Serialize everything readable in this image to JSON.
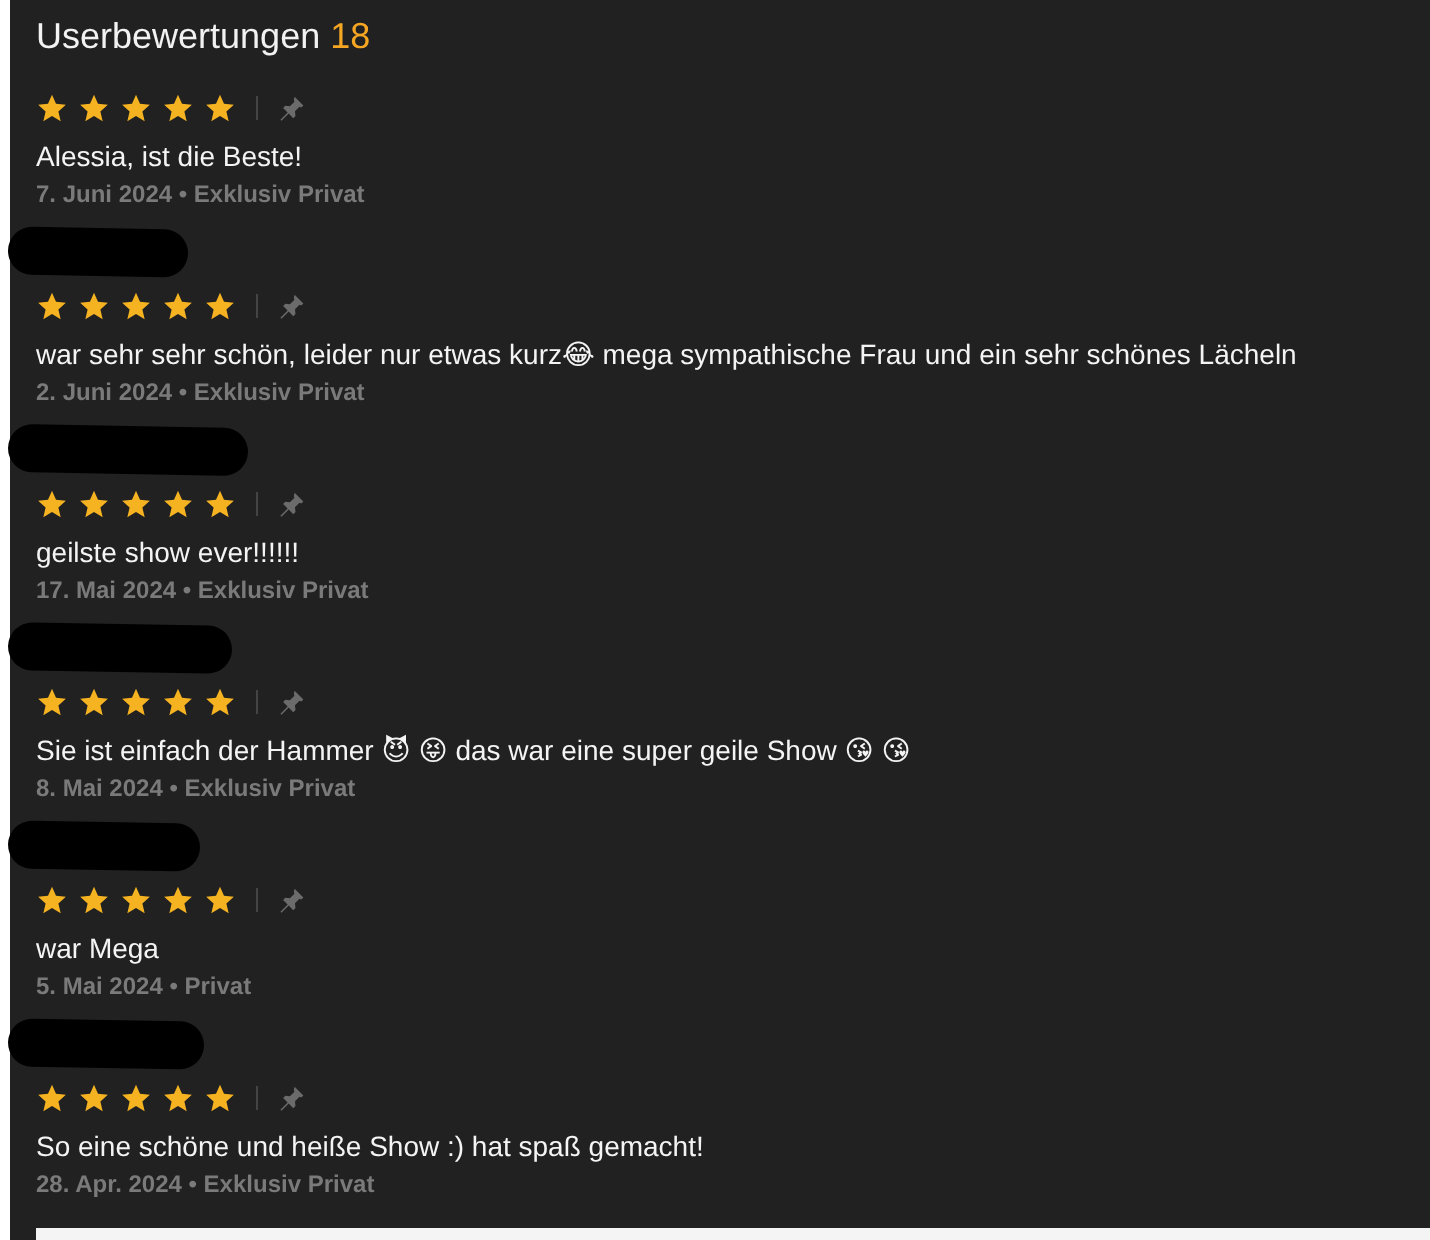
{
  "header": {
    "title": "Userbewertungen",
    "count": "18"
  },
  "reviews": [
    {
      "stars": 5,
      "text": "Alessia, ist die Beste!",
      "meta": "7. Juni 2024 • Exklusiv Privat"
    },
    {
      "name_redacted": true,
      "stars": 5,
      "text": "war sehr sehr schön, leider nur etwas kurz😂 mega sympathische Frau und ein sehr schönes Lächeln",
      "meta": "2. Juni 2024 • Exklusiv Privat"
    },
    {
      "name_redacted": true,
      "stars": 5,
      "text": "geilste show ever!!!!!!",
      "meta": "17. Mai 2024 • Exklusiv Privat"
    },
    {
      "name_redacted": true,
      "stars": 5,
      "text": "Sie ist einfach der Hammer 😈 😝  das war eine super geile Show 😘 😘",
      "meta": "8. Mai 2024 • Exklusiv Privat"
    },
    {
      "name_redacted": true,
      "stars": 5,
      "text": "war Mega",
      "meta": "5. Mai 2024 • Privat"
    },
    {
      "name_redacted": true,
      "stars": 5,
      "text": "So eine schöne und heiße Show :) hat spaß gemacht!",
      "meta": "28. Apr. 2024 • Exklusiv Privat"
    }
  ]
}
